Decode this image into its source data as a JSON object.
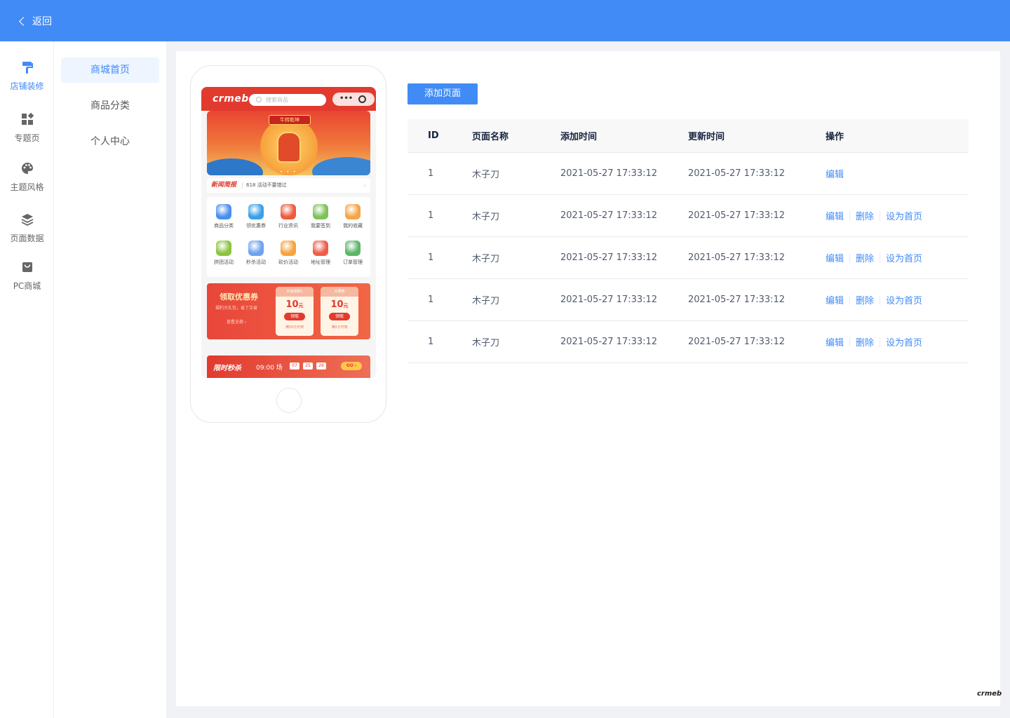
{
  "header": {
    "back_label": "返回"
  },
  "rail": {
    "items": [
      {
        "label": "店铺装修",
        "icon": "paint-roller-icon",
        "active": true
      },
      {
        "label": "专题页",
        "icon": "grid-icon",
        "active": false
      },
      {
        "label": "主题风格",
        "icon": "palette-icon",
        "active": false
      },
      {
        "label": "页面数据",
        "icon": "layers-icon",
        "active": false
      },
      {
        "label": "PC商城",
        "icon": "shop-bag-icon",
        "active": false
      }
    ]
  },
  "subnav": {
    "items": [
      {
        "label": "商城首页",
        "active": true
      },
      {
        "label": "商品分类",
        "active": false
      },
      {
        "label": "个人中心",
        "active": false
      }
    ]
  },
  "preview": {
    "logo": "crmeb",
    "search_placeholder": "搜索商品",
    "capsule_dots": "•••",
    "banner_title": "牛转乾坤",
    "banner_dots": "• • •",
    "news_tag": "新闻简报",
    "news_text": "618 活动不要错过",
    "news_arrow": "›",
    "grid": [
      {
        "label": "商品分类",
        "icon": "category-icon",
        "color": "#4a8ff0"
      },
      {
        "label": "领优惠券",
        "icon": "coupon-icon",
        "color": "#3aa0e8"
      },
      {
        "label": "行业资讯",
        "icon": "news-icon",
        "color": "#ef5a3c"
      },
      {
        "label": "我要签到",
        "icon": "sign-in-icon",
        "color": "#7cc25a"
      },
      {
        "label": "我的收藏",
        "icon": "favorite-icon",
        "color": "#f5a545"
      },
      {
        "label": "拼团活动",
        "icon": "group-buy-icon",
        "color": "#8cc43e"
      },
      {
        "label": "秒杀活动",
        "icon": "flash-sale-icon",
        "color": "#6ea2f0"
      },
      {
        "label": "砍价活动",
        "icon": "bargain-icon",
        "color": "#f6a33d"
      },
      {
        "label": "地址管理",
        "icon": "address-icon",
        "color": "#ee5d48"
      },
      {
        "label": "订单管理",
        "icon": "order-icon",
        "color": "#5bb56a"
      }
    ],
    "coupon": {
      "title": "领取优惠券",
      "sub": "福利大礼包，省了又省",
      "all": "查看全部 ›",
      "cards": [
        {
          "head": "手动领取1",
          "amount": "10",
          "unit": "元",
          "action": "领取",
          "foot": "满50元可用"
        },
        {
          "head": "大惠券",
          "amount": "10",
          "unit": "元",
          "action": "领取",
          "foot": "满0元可用"
        }
      ]
    },
    "seckill": {
      "title": "限时秒杀",
      "time": "09:00 场",
      "h": "07",
      "m": "25",
      "s": "26",
      "go": "GO ›"
    }
  },
  "toolbar": {
    "add_label": "添加页面"
  },
  "table": {
    "headers": {
      "id": "ID",
      "name": "页面名称",
      "add_time": "添加时间",
      "update_time": "更新时间",
      "ops": "操作"
    },
    "rows": [
      {
        "id": "1",
        "name": "木子刀",
        "add_time": "2021-05-27 17:33:12",
        "update_time": "2021-05-27 17:33:12",
        "ops": [
          "编辑"
        ]
      },
      {
        "id": "1",
        "name": "木子刀",
        "add_time": "2021-05-27 17:33:12",
        "update_time": "2021-05-27 17:33:12",
        "ops": [
          "编辑",
          "删除",
          "设为首页"
        ]
      },
      {
        "id": "1",
        "name": "木子刀",
        "add_time": "2021-05-27 17:33:12",
        "update_time": "2021-05-27 17:33:12",
        "ops": [
          "编辑",
          "删除",
          "设为首页"
        ]
      },
      {
        "id": "1",
        "name": "木子刀",
        "add_time": "2021-05-27 17:33:12",
        "update_time": "2021-05-27 17:33:12",
        "ops": [
          "编辑",
          "删除",
          "设为首页"
        ]
      },
      {
        "id": "1",
        "name": "木子刀",
        "add_time": "2021-05-27 17:33:12",
        "update_time": "2021-05-27 17:33:12",
        "ops": [
          "编辑",
          "删除",
          "设为首页"
        ]
      }
    ]
  },
  "footer": {
    "logo": "crmeb"
  },
  "colors": {
    "primary": "#418bf6",
    "brand_red": "#e23a2e"
  }
}
